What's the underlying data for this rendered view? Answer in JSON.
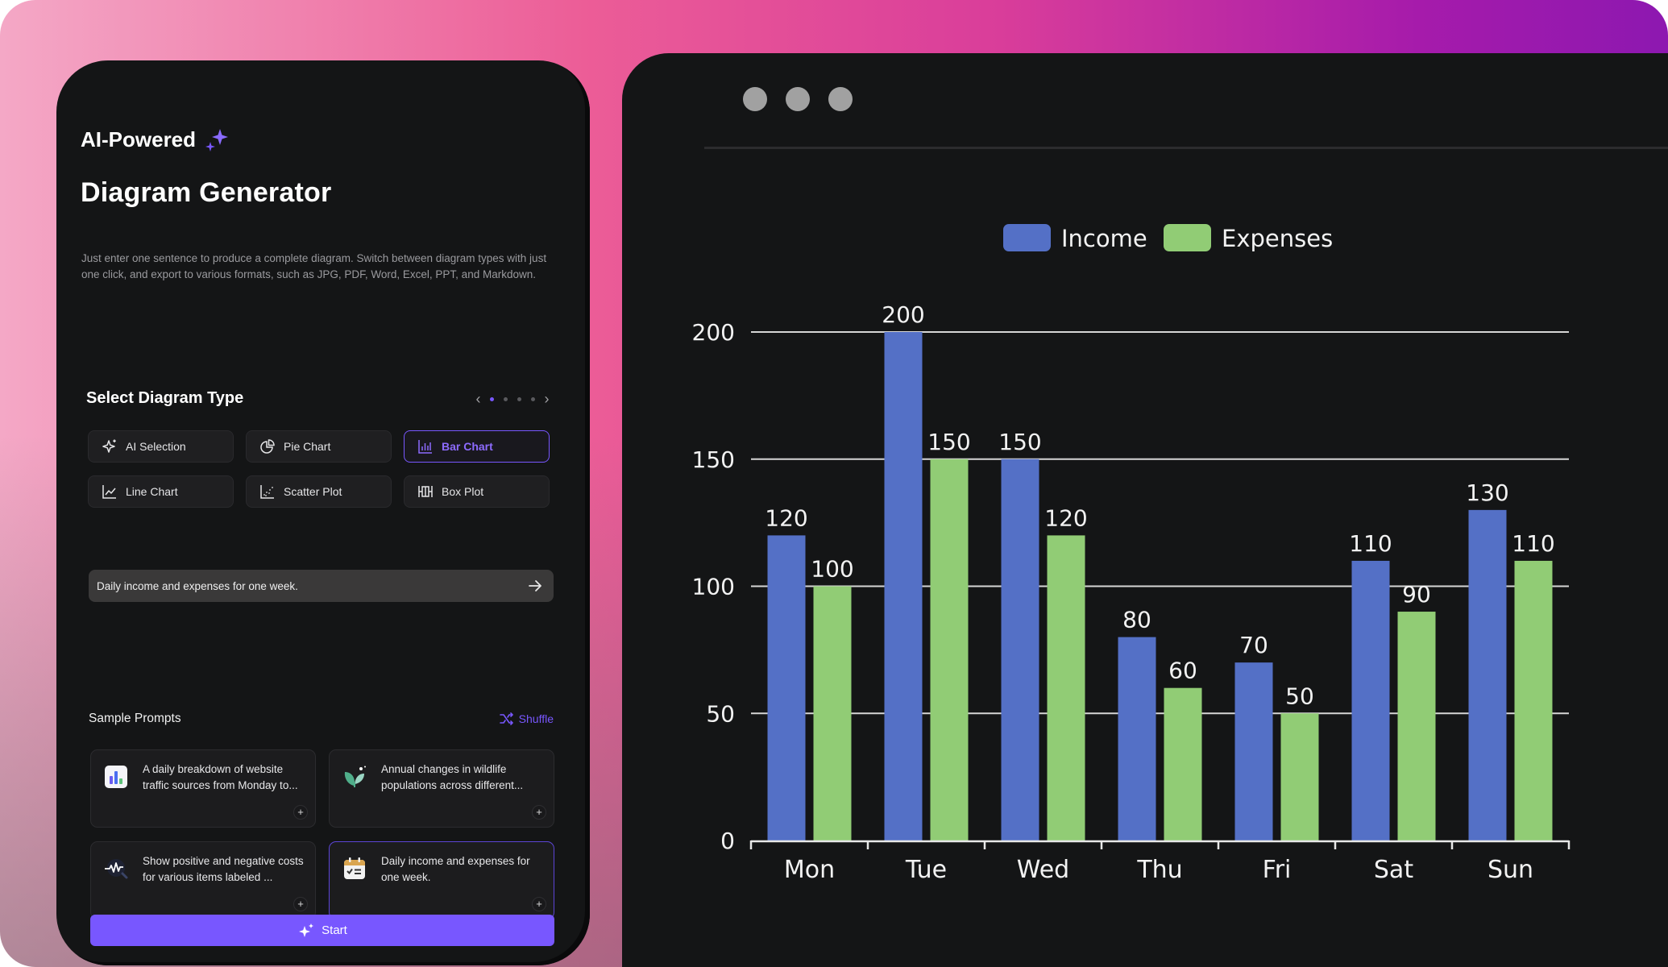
{
  "left": {
    "ai_label": "AI-Powered",
    "title": "Diagram Generator",
    "description": "Just enter one sentence to produce a complete diagram. Switch between diagram types with just one click, and export to various formats, such as JPG, PDF, Word, Excel, PPT, and Markdown.",
    "select_type_title": "Select Diagram Type",
    "pager": {
      "prev": "‹",
      "next": "›",
      "pages": 4,
      "current": 1
    },
    "diagram_types": [
      {
        "label": "AI Selection",
        "icon": "sparkle-icon",
        "active": false
      },
      {
        "label": "Pie Chart",
        "icon": "pie-chart-icon",
        "active": false
      },
      {
        "label": "Bar Chart",
        "icon": "bar-chart-icon",
        "active": true
      },
      {
        "label": "Line Chart",
        "icon": "line-chart-icon",
        "active": false
      },
      {
        "label": "Scatter Plot",
        "icon": "scatter-plot-icon",
        "active": false
      },
      {
        "label": "Box Plot",
        "icon": "box-plot-icon",
        "active": false
      }
    ],
    "prompt_input": {
      "value": "Daily income and expenses for one week.",
      "placeholder": ""
    },
    "sample_prompts_title": "Sample Prompts",
    "shuffle_label": "Shuffle",
    "sample_prompts": [
      {
        "text": "A daily breakdown of website traffic sources from Monday to...",
        "icon": "bar-chart-app-icon",
        "active": false
      },
      {
        "text": "Annual changes in wildlife populations across different...",
        "icon": "leaf-icon",
        "active": false
      },
      {
        "text": "Show positive and negative costs for various items labeled ...",
        "icon": "waveform-search-icon",
        "active": false
      },
      {
        "text": "Daily income and expenses for one week.",
        "icon": "calendar-checklist-icon",
        "active": true
      }
    ],
    "start_label": "Start",
    "accent_color": "#7857ff"
  },
  "chart_data": {
    "type": "bar",
    "title": "",
    "xlabel": "",
    "ylabel": "",
    "categories": [
      "Mon",
      "Tue",
      "Wed",
      "Thu",
      "Fri",
      "Sat",
      "Sun"
    ],
    "series": [
      {
        "name": "Income",
        "color": "#5470c6",
        "values": [
          120,
          200,
          150,
          80,
          70,
          110,
          130
        ]
      },
      {
        "name": "Expenses",
        "color": "#91cc75",
        "values": [
          100,
          150,
          120,
          60,
          50,
          90,
          110
        ]
      }
    ],
    "ylim": [
      0,
      200
    ],
    "yticks": [
      0,
      50,
      100,
      150,
      200
    ],
    "grid": true,
    "legend": "top-center",
    "data_labels": true
  }
}
